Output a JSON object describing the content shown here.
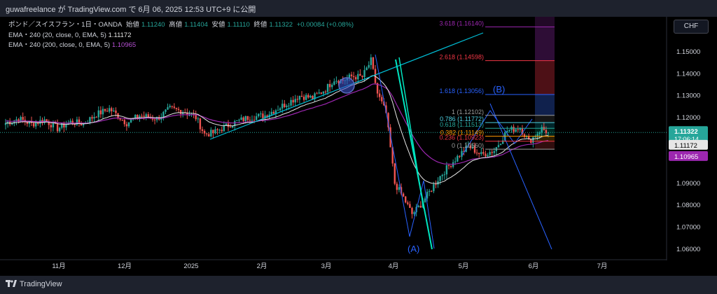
{
  "header": {
    "publish_line": "guwafreelance が TradingView.com で 6月 06, 2025 12:53 UTC+9 に公開"
  },
  "legend": {
    "symbol": "ポンド／スイスフラン・1日・OANDA",
    "open_label": "始値",
    "open": "1.11240",
    "high_label": "高値",
    "high": "1.11404",
    "low_label": "安値",
    "low": "1.11110",
    "close_label": "終値",
    "close": "1.11322",
    "change": "+0.00084 (+0.08%)",
    "ema1_label": "EMA・240 (20, close, 0, EMA, 5)",
    "ema1_value": "1.11172",
    "ema2_label": "EMA・240 (200, close, 0, EMA, 5)",
    "ema2_value": "1.10965"
  },
  "currency_button": "CHF",
  "footer": {
    "brand": "TradingView"
  },
  "colors": {
    "up": "#26a69a",
    "down": "#ef5350",
    "ema20": "#e6e6e6",
    "ema200": "#9c27b0",
    "trendline": "#00bcd4",
    "wave": "#2962ff"
  },
  "chart_data": {
    "type": "candlestick",
    "y_range": [
      1.055,
      1.158
    ],
    "y_ticks": [
      "1.15000",
      "1.14000",
      "1.13000",
      "1.12000",
      "1.11000",
      "1.09000",
      "1.08000",
      "1.07000",
      "1.06000"
    ],
    "x_labels": [
      "11月",
      "12月",
      "2025",
      "2月",
      "3月",
      "4月",
      "5月",
      "6月",
      "7月"
    ],
    "price_labels": {
      "last_price": "1.11322",
      "countdown": "17:06:14",
      "ema20": "1.11172",
      "ema200": "1.10965"
    },
    "fib_levels": [
      {
        "ratio": 3.618,
        "label": "3.618 (1.16140)",
        "price": 1.1614,
        "color": "#9c27b0"
      },
      {
        "ratio": 2.618,
        "label": "2.618 (1.14598)",
        "price": 1.14598,
        "color": "#f23645"
      },
      {
        "ratio": 1.618,
        "label": "1.618 (1.13056)",
        "price": 1.13056,
        "color": "#2962ff"
      },
      {
        "ratio": 1,
        "label": "1 (1.12102)",
        "price": 1.12102,
        "color": "#9e9e9e"
      },
      {
        "ratio": 0.786,
        "label": "0.786 (1.11772)",
        "price": 1.11772,
        "color": "#4dd0e1"
      },
      {
        "ratio": 0.618,
        "label": "0.618 (1.11513)",
        "price": 1.11513,
        "color": "#26a69a"
      },
      {
        "ratio": 0.382,
        "label": "0.382 (1.11149)",
        "price": 1.11149,
        "color": "#ff9800"
      },
      {
        "ratio": 0.236,
        "label": "0.236 (1.10923)",
        "price": 1.10923,
        "color": "#f23645"
      },
      {
        "ratio": 0,
        "label": "0 (1.10560)",
        "price": 1.1056,
        "color": "#9e9e9e"
      }
    ],
    "wave_labels": [
      "(A)",
      "(B)"
    ]
  }
}
